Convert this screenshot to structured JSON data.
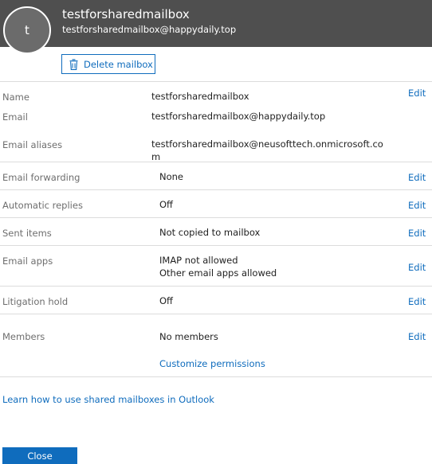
{
  "header": {
    "avatar_initial": "t",
    "title": "testforsharedmailbox",
    "email": "testforsharedmailbox@happydaily.top"
  },
  "actions": {
    "delete_label": "Delete mailbox",
    "delete_icon": "trash-icon"
  },
  "fields": {
    "name": {
      "label": "Name",
      "value": "testforsharedmailbox",
      "edit": "Edit"
    },
    "email": {
      "label": "Email",
      "value": "testforsharedmailbox@happydaily.top"
    },
    "aliases": {
      "label": "Email aliases",
      "value_line1": "testforsharedmailbox@neusofttech.onmicrosoft.co",
      "value_line2": "m"
    },
    "forwarding": {
      "label": "Email forwarding",
      "value": "None",
      "edit": "Edit"
    },
    "auto_replies": {
      "label": "Automatic replies",
      "value": "Off",
      "edit": "Edit"
    },
    "sent_items": {
      "label": "Sent items",
      "value": "Not copied to mailbox",
      "edit": "Edit"
    },
    "email_apps": {
      "label": "Email apps",
      "value_line1": "IMAP not allowed",
      "value_line2": "Other email apps allowed",
      "edit": "Edit"
    },
    "litigation": {
      "label": "Litigation hold",
      "value": "Off",
      "edit": "Edit"
    },
    "members": {
      "label": "Members",
      "value": "No members",
      "edit": "Edit",
      "permissions_link": "Customize permissions"
    }
  },
  "footer": {
    "learn_link": "Learn how to use shared mailboxes in Outlook",
    "close_label": "Close"
  },
  "colors": {
    "header_bg": "#4f4f4f",
    "accent": "#0f6cbd",
    "label_text": "#6e6e6e"
  }
}
